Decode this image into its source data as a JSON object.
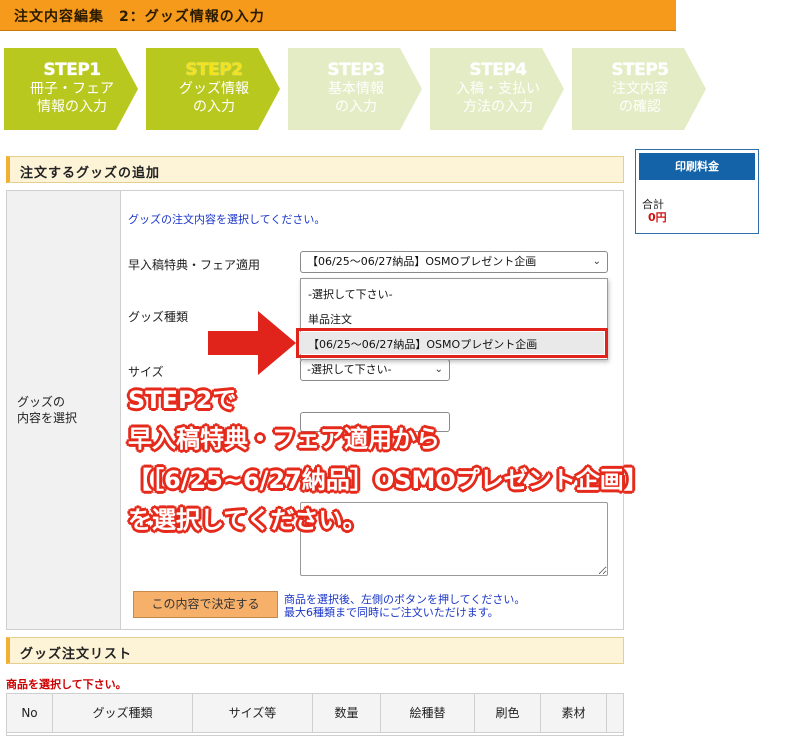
{
  "page": {
    "title": "注文内容編集　2：グッズ情報の入力"
  },
  "steps": [
    {
      "num": "STEP1",
      "line1": "冊子・フェア",
      "line2": "情報の入力",
      "color": "#b8c81e"
    },
    {
      "num": "STEP2",
      "line1": "グッズ情報",
      "line2": "の入力",
      "color": "#b8c81e"
    },
    {
      "num": "STEP3",
      "line1": "基本情報",
      "line2": "の入力",
      "color": "#e3ecc4"
    },
    {
      "num": "STEP4",
      "line1": "入稿・支払い",
      "line2": "方法の入力",
      "color": "#e3ecc4"
    },
    {
      "num": "STEP5",
      "line1": "注文内容",
      "line2": "の確認",
      "color": "#e3ecc4"
    }
  ],
  "add_section": {
    "heading": "注文するグッズの追加",
    "left_label_1": "グッズの",
    "left_label_2": "内容を選択",
    "instruction": "グッズの注文内容を選択してください。",
    "fair_label": "早入稿特典・フェア適用",
    "fair_selected": "【06/25～06/27納品】OSMOプレゼント企画",
    "fair_options": [
      "-選択して下さい-",
      "単品注文",
      "【06/25～06/27納品】OSMOプレゼント企画"
    ],
    "goods_type_label": "グッズ種類",
    "size_label": "サイズ",
    "size_selected": "-選択して下さい-",
    "decide_button": "この内容で決定する",
    "decide_note_1": "商品を選択後、左側のボタンを押してください。",
    "decide_note_2": "最大6種類まで同時にご注文いただけます。"
  },
  "overlay": {
    "line1": "STEP2で",
    "line2": "早入稿特典・フェア適用から",
    "line3": "【［6/25~6/27納品］OSMOプレゼント企画】",
    "line4": "を選択してください。"
  },
  "side": {
    "heading": "印刷料金",
    "total_label": "合計",
    "total_value": "0円"
  },
  "list_section": {
    "heading": "グッズ注文リスト",
    "note": "商品を選択して下さい。",
    "columns": [
      "No",
      "グッズ種類",
      "サイズ等",
      "数量",
      "絵種替",
      "刷色",
      "素材"
    ]
  },
  "colors": {
    "title_bar": "#f59a1b",
    "accent_red": "#e52a1b",
    "price_head": "#1463a8"
  }
}
